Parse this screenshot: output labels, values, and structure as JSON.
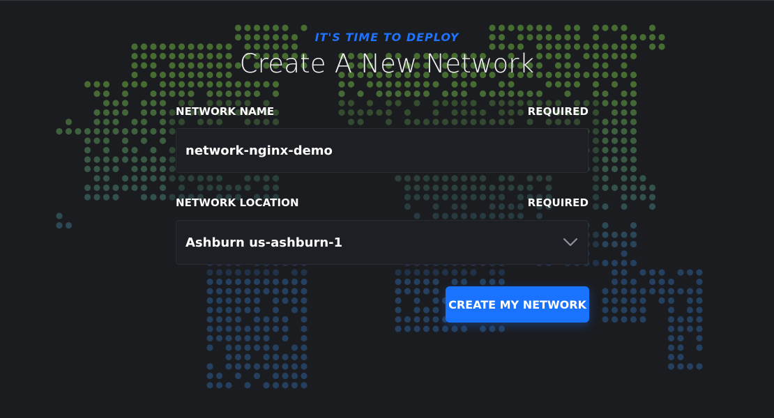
{
  "header": {
    "eyebrow": "IT'S TIME TO DEPLOY",
    "title": "Create A New Network"
  },
  "form": {
    "name_label": "NETWORK NAME",
    "name_required": "REQUIRED",
    "name_value": "network-nginx-demo",
    "location_label": "NETWORK LOCATION",
    "location_required": "REQUIRED",
    "location_value": "Ashburn us-ashburn-1",
    "submit_label": "CREATE MY NETWORK"
  },
  "icons": {
    "dropdown": "chevron-down-icon",
    "background": "dotted-world-map"
  },
  "colors": {
    "background": "#1b1c20",
    "accent": "#1a73ff",
    "map_north": "#4f7a36",
    "map_south": "#27456a"
  }
}
